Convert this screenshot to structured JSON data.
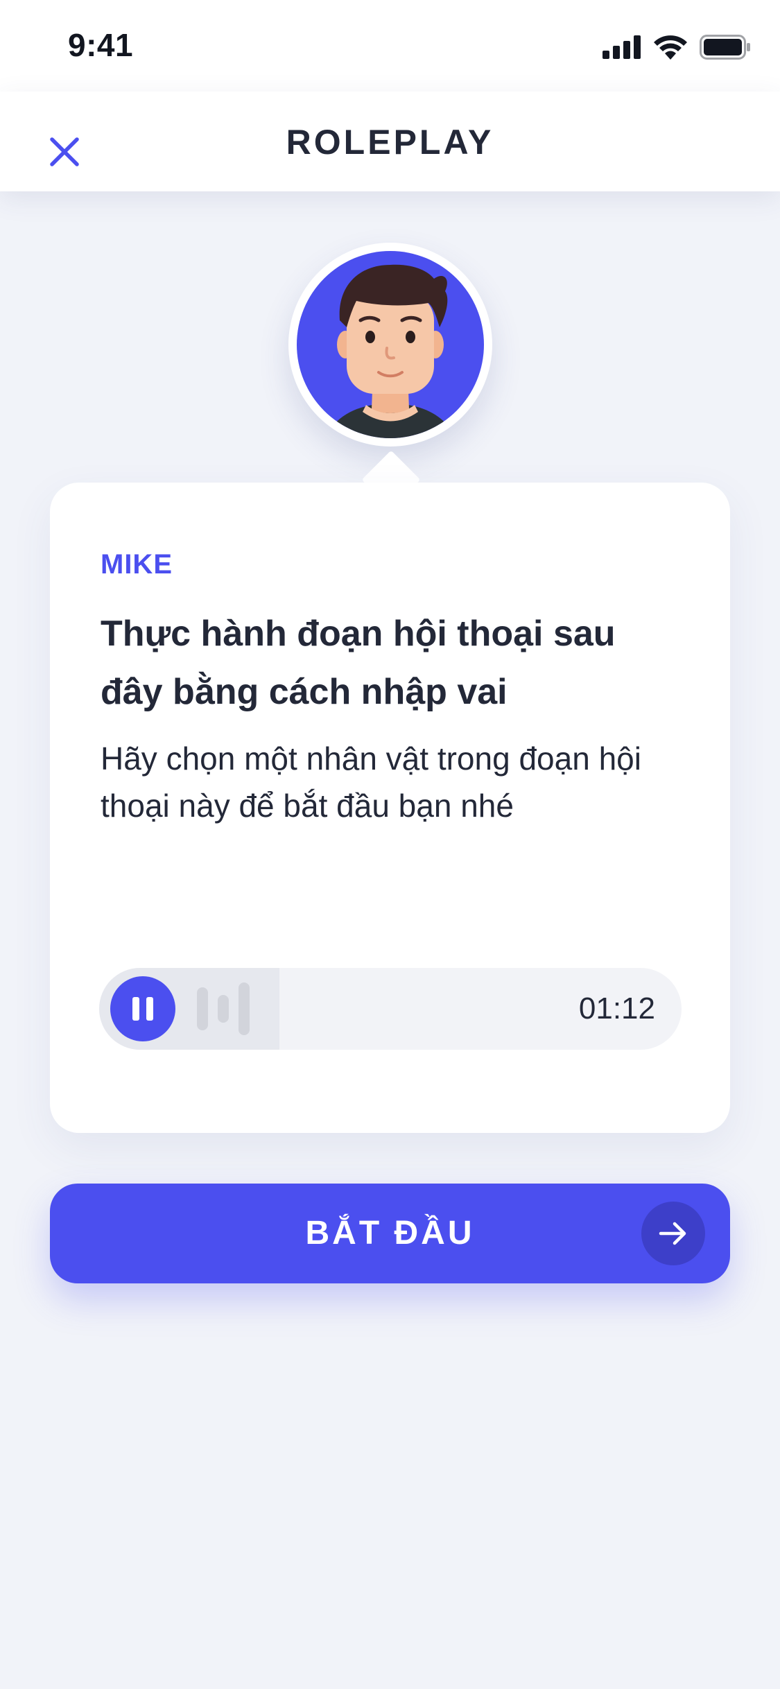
{
  "status_bar": {
    "time": "9:41",
    "icons": [
      "signal-icon",
      "wifi-icon",
      "battery-icon"
    ]
  },
  "header": {
    "title": "ROLEPLAY",
    "close_icon": "close-icon"
  },
  "card": {
    "speaker": "MIKE",
    "title": "Thực hành đoạn hội thoại sau đây bằng cách nhập vai",
    "description": "Hãy chọn một nhân vật trong đoạn hội thoại này để bắt đầu bạn nhé",
    "audio": {
      "time": "01:12",
      "state_icon": "pause-icon",
      "progress": 0.31
    }
  },
  "start_button": {
    "label": "BẮT ĐẦU",
    "icon": "arrow-right-icon"
  },
  "colors": {
    "accent": "#4B4FEF",
    "background": "#F1F3F9",
    "text": "#232838"
  }
}
